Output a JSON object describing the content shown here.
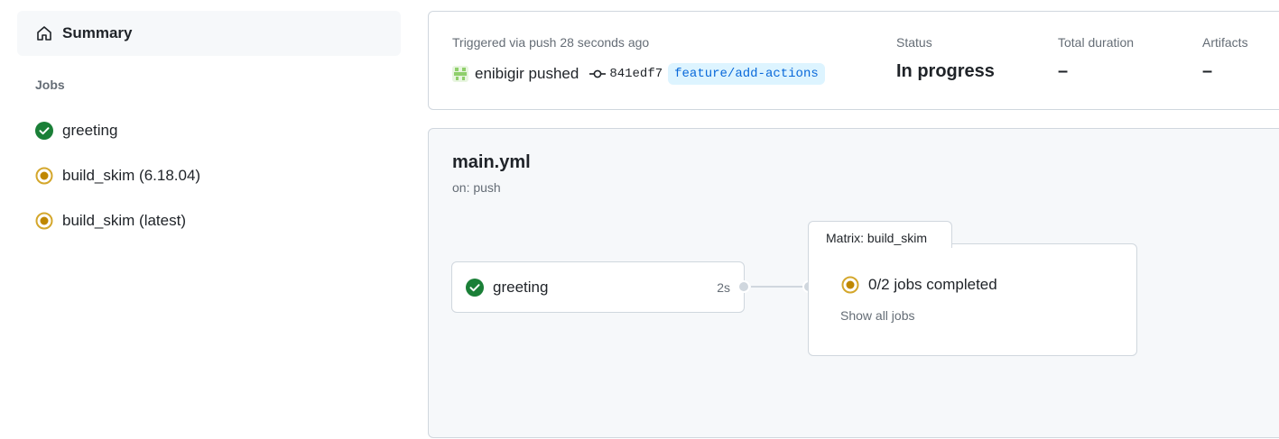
{
  "sidebar": {
    "summary_label": "Summary",
    "summary_icon": "home-icon",
    "jobs_heading": "Jobs",
    "jobs": [
      {
        "label": "greeting",
        "status": "success"
      },
      {
        "label": "build_skim (6.18.04)",
        "status": "in_progress"
      },
      {
        "label": "build_skim (latest)",
        "status": "in_progress"
      }
    ]
  },
  "run_info": {
    "trigger_text": "Triggered via push 28 seconds ago",
    "actor": "enibigir pushed",
    "commit_sha": "841edf7",
    "branch": "feature/add-actions",
    "status_label": "Status",
    "status_value": "In progress",
    "duration_label": "Total duration",
    "duration_value": "–",
    "artifacts_label": "Artifacts",
    "artifacts_value": "–"
  },
  "workflow": {
    "name": "main.yml",
    "trigger": "on: push",
    "job_node": {
      "label": "greeting",
      "duration": "2s"
    },
    "matrix": {
      "tab_label": "Matrix: build_skim",
      "status_text": "0/2 jobs completed",
      "show_all_label": "Show all jobs"
    }
  },
  "colors": {
    "success": "#1a7f37",
    "in_progress": "#bf8700",
    "link_blue": "#0969da",
    "branch_bg": "#ddf4ff"
  }
}
